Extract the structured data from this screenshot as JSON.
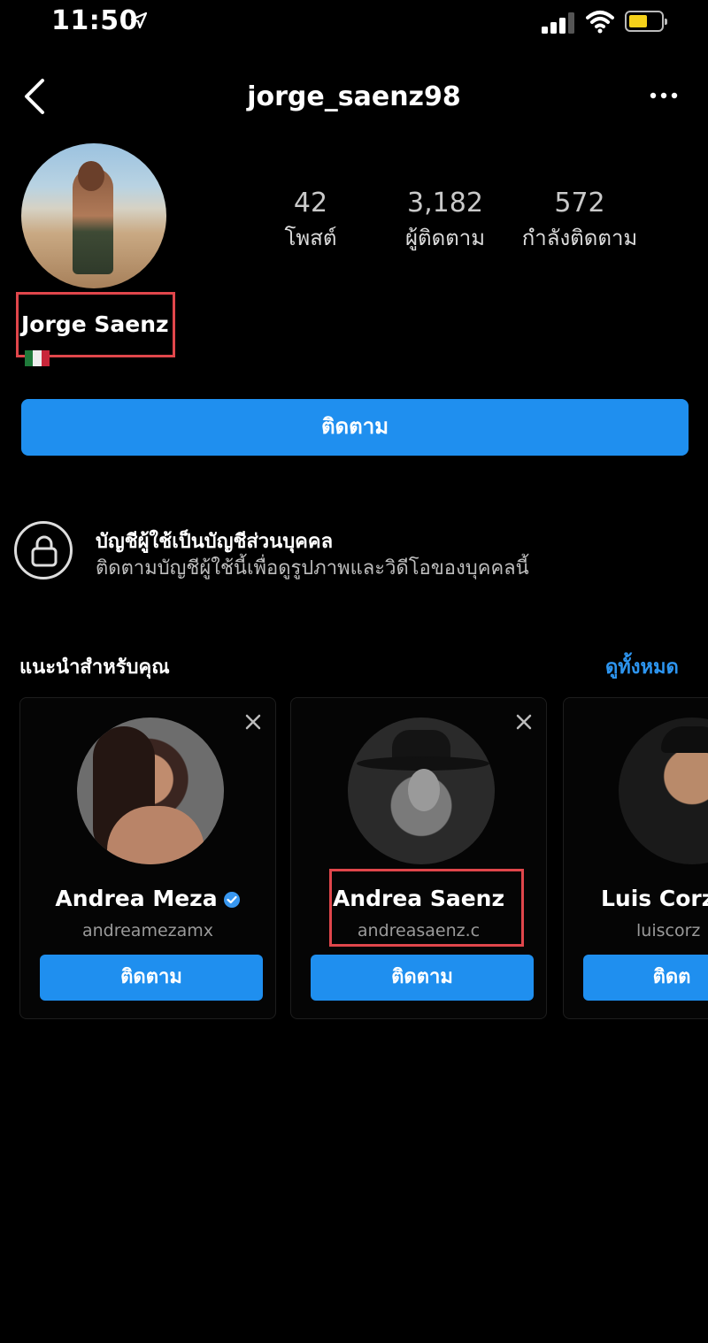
{
  "status_bar": {
    "time": "11:50"
  },
  "nav": {
    "title": "jorge_saenz98"
  },
  "profile": {
    "display_name": "Jorge Saenz",
    "stats": [
      {
        "value": "42",
        "label": "โพสต์"
      },
      {
        "value": "3,182",
        "label": "ผู้ติดตาม"
      },
      {
        "value": "572",
        "label": "กำลังติดตาม"
      }
    ],
    "follow_label": "ติดตาม"
  },
  "private_notice": {
    "title": "บัญชีผู้ใช้เป็นบัญชีส่วนบุคคล",
    "subtitle": "ติดตามบัญชีผู้ใช้นี้เพื่อดูรูปภาพและวิดีโอของบุคคลนี้"
  },
  "suggestions": {
    "heading": "แนะนำสำหรับคุณ",
    "see_all": "ดูทั้งหมด",
    "items": [
      {
        "name": "Andrea Meza",
        "username": "andreamezamx",
        "verified": true,
        "follow_label": "ติดตาม"
      },
      {
        "name": "Andrea Saenz",
        "username": "andreasaenz.c",
        "verified": false,
        "follow_label": "ติดตาม"
      },
      {
        "name": "Luis Corz",
        "username": "luiscorz",
        "verified": false,
        "follow_label": "ติดต"
      }
    ]
  },
  "colors": {
    "accent": "#1f8fef",
    "highlight": "#e0464b",
    "background": "#000000"
  }
}
